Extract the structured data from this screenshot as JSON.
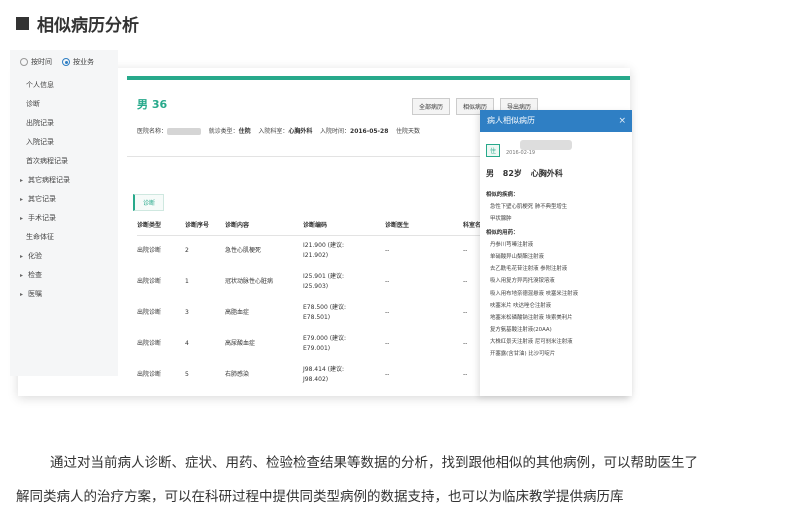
{
  "heading": "相似病历分析",
  "sidebar": {
    "radio_time": "按时间",
    "radio_business": "按业务",
    "items": [
      "个人信息",
      "诊断",
      "出院记录",
      "入院记录",
      "首次病程记录"
    ],
    "groups": [
      {
        "label": "其它病程记录",
        "type": "group"
      },
      {
        "label": "其它记录",
        "type": "group"
      },
      {
        "label": "手术记录",
        "type": "group"
      },
      {
        "label": "生命体征",
        "type": "item"
      },
      {
        "label": "化验",
        "type": "group"
      },
      {
        "label": "检查",
        "type": "group"
      },
      {
        "label": "医嘱",
        "type": "group"
      }
    ]
  },
  "record": {
    "title": "男  36",
    "buttons": [
      "全部病历",
      "相似病历",
      "导出病历"
    ],
    "hospital_label": "医院名称：",
    "visit_type_label": "就诊类型：",
    "visit_type": "住院",
    "dept_label": "入院科室：",
    "dept": "心胸外科",
    "admit_label": "入院时间：",
    "admit_date": "2016-05-28",
    "days_label": "住院天数",
    "tab": "诊断",
    "table": {
      "headers": [
        "诊断类型",
        "诊断序号",
        "诊断内容",
        "诊断编码",
        "诊断医生",
        "科室名"
      ],
      "rows": [
        [
          "出院诊断",
          "2",
          "急性心肌梗死",
          "I21.900 (建议:",
          "I21.902)",
          "--",
          "--"
        ],
        [
          "出院诊断",
          "1",
          "冠状动脉性心脏病",
          "I25.901 (建议:",
          "I25.903)",
          "--",
          "--"
        ],
        [
          "出院诊断",
          "3",
          "高脂血症",
          "E78.500 (建议:",
          "E78.501)",
          "--",
          "--"
        ],
        [
          "出院诊断",
          "4",
          "高尿酸血症",
          "E79.000 (建议:",
          "E79.001)",
          "--",
          "--"
        ],
        [
          "出院诊断",
          "5",
          "右肺感染",
          "J98.414 (建议:",
          "J98.402)",
          "--",
          "--"
        ]
      ]
    }
  },
  "panel": {
    "title": "病人相似病历",
    "close": "×",
    "tag": "住",
    "date": "2016-02-19",
    "patient": "男  82岁  心胸外科",
    "similar_dx_label": "相似的疾病：",
    "similar_dx": [
      "急性下壁心肌梗死  肺不典型增生",
      "甲状腺肿"
    ],
    "similar_drug_label": "相似的用药：",
    "similar_drugs": [
      "丹参川芎嗪注射液",
      "单硝酸异山梨酯注射液",
      "去乙酰毛花苷注射液  参附注射液",
      "吸入用复方异丙托溴铵溶液",
      "吸入用布地奈德混悬液  呋塞米注射液",
      "呋塞米片  呋达唑仑注射液",
      "地塞米松磷酸钠注射液  埃索美利片",
      "复方氨基酸注射液(20AA)",
      "大株红景天注射液  尼可刹米注射液",
      "开塞露(含甘油)  比沙可啶片"
    ]
  },
  "paragraph1": "通过对当前病人诊断、症状、用药、检验检查结果等数据的分析，找到跟他相似的其他病例，可以帮助医生了",
  "paragraph2": "解同类病人的治疗方案，可以在科研过程中提供同类型病例的数据支持，也可以为临床教学提供病历库"
}
